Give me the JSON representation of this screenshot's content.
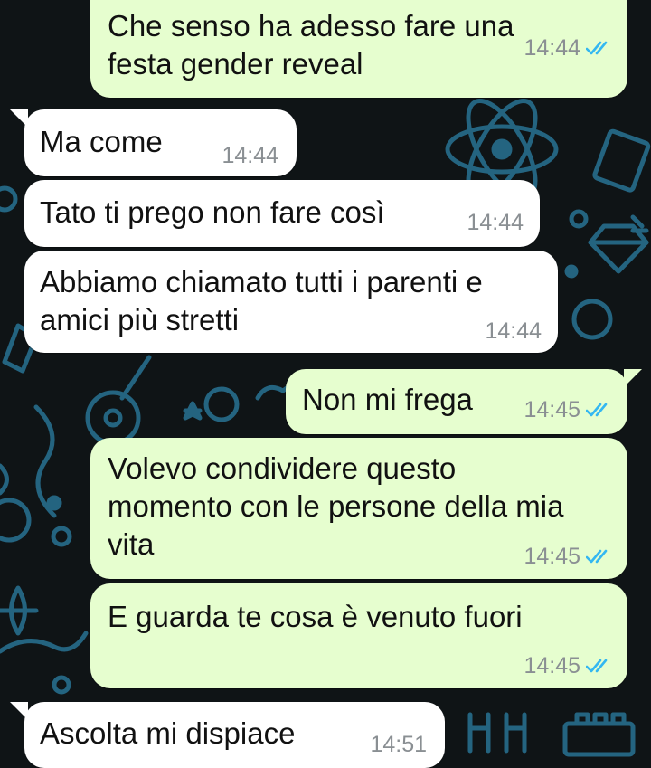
{
  "colors": {
    "incoming_bubble": "#ffffff",
    "outgoing_bubble": "#e6fecf",
    "timestamp": "#8a8f93",
    "read_ticks": "#34b7f1",
    "wallpaper": "#0f1416",
    "doodles": "#2b7fa4"
  },
  "messages": [
    {
      "direction": "outgoing",
      "text": "Che senso ha adesso fare una\nfesta gender reveal",
      "time": "14:44",
      "status": "read-double-check-icon"
    },
    {
      "direction": "incoming",
      "text": "Ma come",
      "time": "14:44"
    },
    {
      "direction": "incoming",
      "text": "Tato ti prego non fare così",
      "time": "14:44"
    },
    {
      "direction": "incoming",
      "text": "Abbiamo chiamato tutti i parenti e\namici più stretti",
      "time": "14:44"
    },
    {
      "direction": "outgoing",
      "text": "Non mi frega",
      "time": "14:45",
      "status": "read-double-check-icon"
    },
    {
      "direction": "outgoing",
      "text": "Volevo condividere questo\nmomento con le persone della mia\nvita",
      "time": "14:45",
      "status": "read-double-check-icon"
    },
    {
      "direction": "outgoing",
      "text": "E guarda te cosa è venuto fuori",
      "time": "14:45",
      "status": "read-double-check-icon"
    },
    {
      "direction": "incoming",
      "text": "Ascolta mi dispiace",
      "time": "14:51"
    }
  ]
}
